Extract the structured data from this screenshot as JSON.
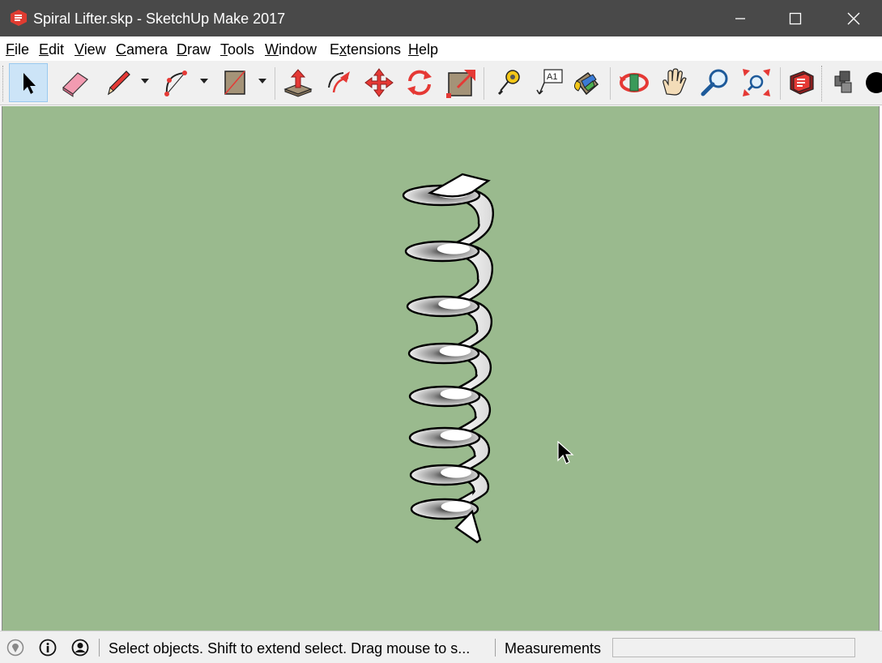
{
  "window": {
    "title": "Spiral Lifter.skp - SketchUp Make 2017",
    "app_icon": "sketchup-logo-icon",
    "controls": [
      "minimize-icon",
      "maximize-icon",
      "close-icon"
    ]
  },
  "menu": {
    "items": [
      {
        "label": "File",
        "mnemonic": "F"
      },
      {
        "label": "Edit",
        "mnemonic": "E"
      },
      {
        "label": "View",
        "mnemonic": "V"
      },
      {
        "label": "Camera",
        "mnemonic": "C"
      },
      {
        "label": "Draw",
        "mnemonic": "D"
      },
      {
        "label": "Tools",
        "mnemonic": "T"
      },
      {
        "label": "Window",
        "mnemonic": "W"
      },
      {
        "label": "Extensions",
        "mnemonic": "x"
      },
      {
        "label": "Help",
        "mnemonic": "H"
      }
    ]
  },
  "toolbar": {
    "tools": [
      {
        "name": "select-tool",
        "icon": "arrow-cursor-icon",
        "selected": true
      },
      {
        "name": "eraser-tool",
        "icon": "eraser-icon",
        "selected": false
      },
      {
        "name": "line-tool",
        "icon": "pencil-icon",
        "selected": false,
        "has_dropdown": true
      },
      {
        "name": "arc-tool",
        "icon": "arc-icon",
        "selected": false,
        "has_dropdown": true
      },
      {
        "name": "rectangle-tool",
        "icon": "rectangle-icon",
        "selected": false,
        "has_dropdown": true
      },
      {
        "name": "push-pull-tool",
        "icon": "push-pull-icon",
        "selected": false
      },
      {
        "name": "offset-tool",
        "icon": "offset-icon",
        "selected": false
      },
      {
        "name": "move-tool",
        "icon": "move-arrows-icon",
        "selected": false
      },
      {
        "name": "rotate-tool",
        "icon": "rotate-icon",
        "selected": false
      },
      {
        "name": "scale-tool",
        "icon": "scale-icon",
        "selected": false
      },
      {
        "name": "tape-measure-tool",
        "icon": "tape-measure-icon",
        "selected": false
      },
      {
        "name": "text-tool",
        "icon": "text-label-icon",
        "label": "A1",
        "selected": false
      },
      {
        "name": "paint-bucket-tool",
        "icon": "paint-bucket-icon",
        "selected": false
      },
      {
        "name": "orbit-tool",
        "icon": "orbit-icon",
        "selected": false
      },
      {
        "name": "pan-tool",
        "icon": "hand-icon",
        "selected": false
      },
      {
        "name": "zoom-tool",
        "icon": "magnifier-icon",
        "selected": false
      },
      {
        "name": "zoom-extents-tool",
        "icon": "zoom-extents-icon",
        "selected": false
      },
      {
        "name": "warehouse-tool",
        "icon": "3d-warehouse-icon",
        "selected": false
      },
      {
        "name": "components-tool",
        "icon": "components-icon",
        "selected": false
      },
      {
        "name": "styles-tool",
        "icon": "black-circle-icon",
        "selected": false
      }
    ]
  },
  "viewport": {
    "background_color": "#9aba8e",
    "model": "spiral-lifter-helix",
    "cursor": "arrow-cursor-icon"
  },
  "status": {
    "icons": [
      "geo-location-icon",
      "info-icon",
      "user-account-icon"
    ],
    "message": "Select objects. Shift to extend select. Drag mouse to s...",
    "measurements_label": "Measurements",
    "measurements_value": ""
  },
  "colors": {
    "titlebar": "#494949",
    "viewport": "#9aba8e",
    "selected_tool": "#cce4f7"
  }
}
